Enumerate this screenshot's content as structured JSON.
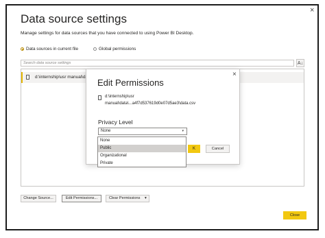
{
  "window": {
    "close_glyph": "×"
  },
  "title": "Data source settings",
  "subtitle": "Manage settings for data sources that you have connected to using Power BI Desktop.",
  "scope": {
    "options": [
      {
        "label": "Data sources in current file",
        "checked": true
      },
      {
        "label": "Global permissions",
        "checked": false
      }
    ]
  },
  "search": {
    "placeholder": "Search data source settings",
    "sort_glyph": "A↓"
  },
  "list": {
    "items": [
      {
        "label": "d:\\internship\\usr manual\\data\\...a4f7d537619d0e07d5ae3\\data.csv",
        "icon": "file-icon"
      }
    ]
  },
  "bottom_buttons": {
    "change_source": "Change Source...",
    "edit_permissions": "Edit Permissions...",
    "clear_permissions": "Clear Permissions",
    "clear_arrow": "▾"
  },
  "close_button": "Close",
  "modal": {
    "title": "Edit Permissions",
    "close_glyph": "×",
    "path_line1": "d:\\internship\\usr",
    "path_line2": "manual\\data\\...a4f7d537619d0e07d5ae3\\data.csv",
    "privacy_label": "Privacy Level",
    "selected": "None",
    "dropdown_arrow": "▾",
    "options": [
      "None",
      "Public",
      "Organizational",
      "Private"
    ],
    "hovered_option": "Public",
    "ok_label": "OK",
    "ok_visible": "K",
    "cancel_label": "Cancel"
  },
  "colors": {
    "accent": "#f2c811",
    "selected_border": "#e6b800",
    "hover": "#d2d0ce"
  }
}
